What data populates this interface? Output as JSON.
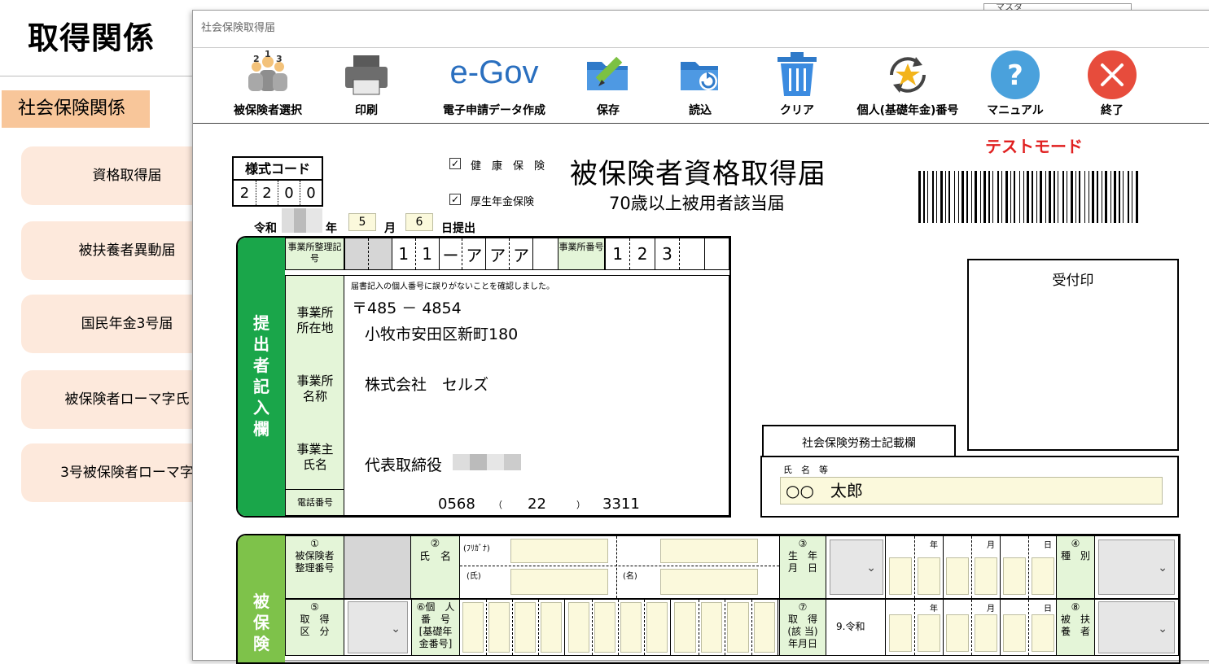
{
  "background_app": {
    "title": "取得関係",
    "section": "社会保険関係",
    "buttons": [
      "資格取得届",
      "被扶養者異動届",
      "国民年金3号届",
      "被保険者ローマ字氏",
      "3号被保険者ローマ字"
    ],
    "top_right": "マスタ"
  },
  "dialog": {
    "title": "社会保険取得届",
    "toolbar": [
      {
        "label": "被保険者選択",
        "icon": "people-select-icon"
      },
      {
        "label": "印刷",
        "icon": "printer-icon"
      },
      {
        "label": "電子申請データ作成",
        "icon": "egov-logo-icon",
        "logo_text": "e-Gov"
      },
      {
        "label": "保存",
        "icon": "folder-pencil-icon"
      },
      {
        "label": "読込",
        "icon": "folder-load-icon"
      },
      {
        "label": "クリア",
        "icon": "trash-icon"
      },
      {
        "label": "個人(基礎年金)番号",
        "icon": "star-refresh-icon"
      },
      {
        "label": "マニュアル",
        "icon": "help-icon"
      },
      {
        "label": "終了",
        "icon": "close-icon"
      }
    ]
  },
  "form": {
    "test_mode": "テストモード",
    "style_code_label": "様式コード",
    "style_code_digits": [
      "2",
      "2",
      "0",
      "0"
    ],
    "checks": [
      {
        "label": "健　康　保　険",
        "checked": true
      },
      {
        "label": "厚生年金保険",
        "checked": true
      }
    ],
    "title": "被保険者資格取得届",
    "subtitle": "70歳以上被用者該当届",
    "date": {
      "era": "令和",
      "year_label": "年",
      "month": "5",
      "month_label": "月",
      "day": "6",
      "day_label": "日提出"
    },
    "submitter_side_label": "提出者記入欄",
    "office_code_label": "事業所整理記号",
    "office_code_chars": [
      "",
      "",
      "1",
      "1",
      "ー",
      "ア",
      "ア",
      "ア",
      ""
    ],
    "office_no_label": "事業所番号",
    "office_no_chars": [
      "1",
      "2",
      "3",
      "",
      ""
    ],
    "confirm_note": "届書記入の個人番号に誤りがないことを確認しました。",
    "address_label": "事業所所在地",
    "postal": "〒485 － 4854",
    "address": "小牧市安田区新町180",
    "name_label": "事業所名　称",
    "company_name": "株式会社　セルズ",
    "owner_label": "事業主氏　名",
    "owner": "代表取締役",
    "phone_label": "電話番号",
    "phone": {
      "area": "0568",
      "open": "（",
      "local": "22",
      "close": "）",
      "number": "3311"
    },
    "reception_stamp": "受付印",
    "sharoushi_label": "社会保険労務士記載欄",
    "sharoushi_name_label": "氏　名　等",
    "sharoushi_name": "○○　太郎",
    "insured_side_label": "被保険",
    "row1": {
      "c1": "①\n被保険者\n整理番号",
      "c2": "②\n氏　名",
      "furigana": "(ﾌﾘｶﾞﾅ)",
      "family": "(氏)",
      "given": "(名)",
      "c3": "③\n生　年\n月　日",
      "y": "年",
      "m": "月",
      "d": "日",
      "c4": "④\n種　別"
    },
    "row2": {
      "c5": "⑤\n取　得\n区　分",
      "c6": "⑥個　人\n番　号\n[基礎年\n金番号]",
      "c7": "⑦\n取　得\n(該 当)\n年月日",
      "era": "9.令和",
      "y": "年",
      "m": "月",
      "d": "日",
      "c8": "⑧\n被　扶\n養　者"
    }
  }
}
